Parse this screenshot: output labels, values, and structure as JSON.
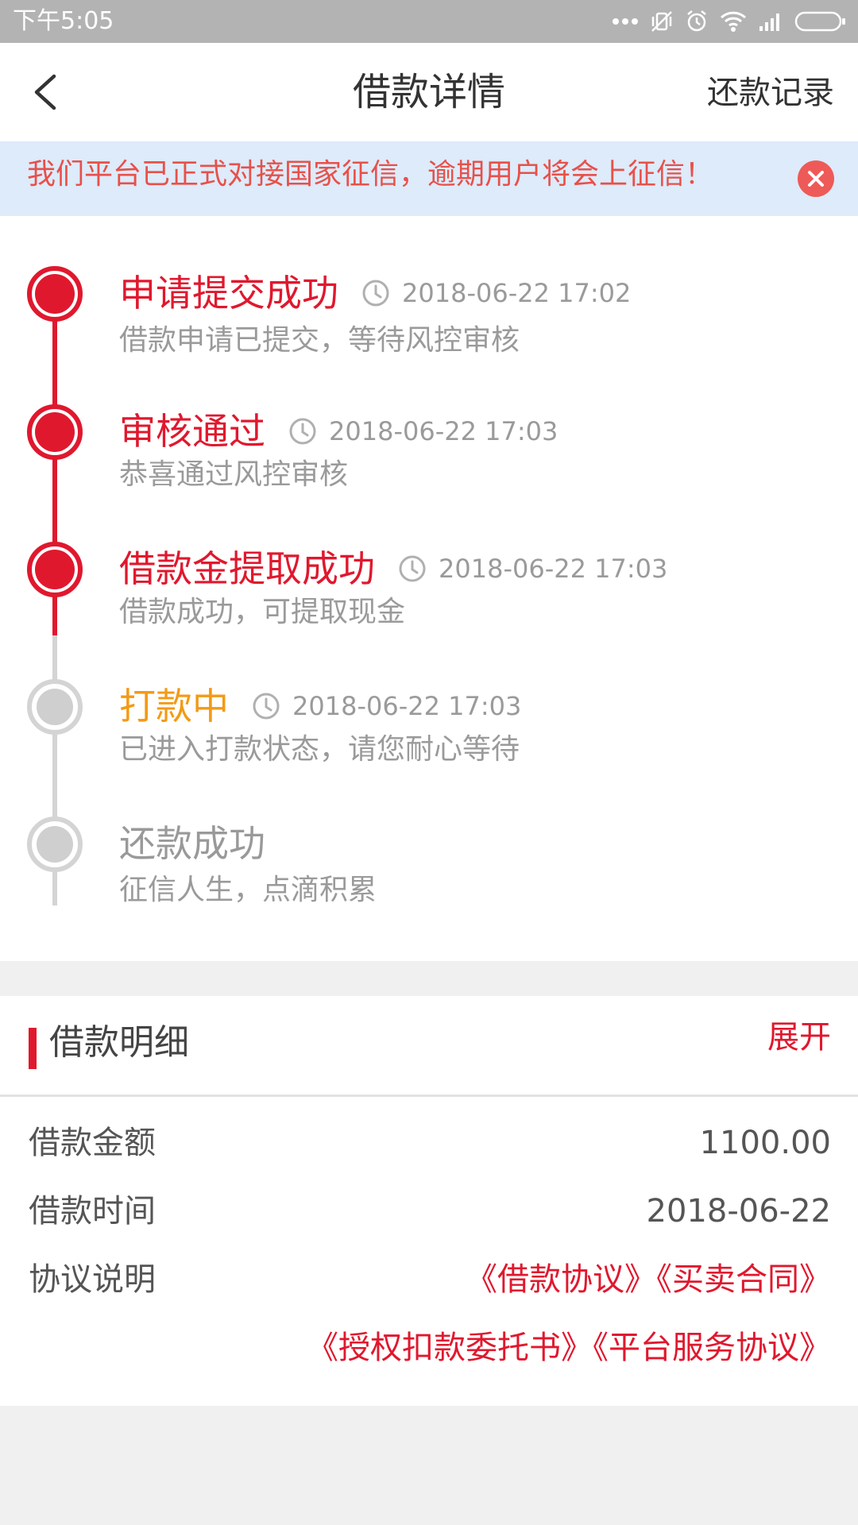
{
  "status_bar": {
    "time": "下午5:05",
    "icons": [
      "more-dots-icon",
      "vibrate-off-icon",
      "alarm-icon",
      "wifi-icon",
      "signal-icon",
      "battery-icon"
    ]
  },
  "nav": {
    "title": "借款详情",
    "right_label": "还款记录",
    "back_icon": "chevron-left-icon"
  },
  "notice": {
    "text": "我们平台已正式对接国家征信，逾期用户将会上征信！",
    "close_icon": "close-icon"
  },
  "timeline": {
    "steps": [
      {
        "title": "申请提交成功",
        "time": "2018-06-22 17:02",
        "desc": "借款申请已提交，等待风控审核",
        "state": "done"
      },
      {
        "title": "审核通过",
        "time": "2018-06-22 17:03",
        "desc": "恭喜通过风控审核",
        "state": "done"
      },
      {
        "title": "借款金提取成功",
        "time": "2018-06-22 17:03",
        "desc": "借款成功，可提取现金",
        "state": "done"
      },
      {
        "title": "打款中",
        "time": "2018-06-22 17:03",
        "desc": "已进入打款状态，请您耐心等待",
        "state": "current"
      },
      {
        "title": "还款成功",
        "time": "",
        "desc": "征信人生，点滴积累",
        "state": "pending"
      }
    ]
  },
  "details": {
    "title": "借款明细",
    "toggle_label": "展开",
    "rows": [
      {
        "label": "借款金额",
        "value": "1100.00"
      },
      {
        "label": "借款时间",
        "value": "2018-06-22"
      },
      {
        "label": "协议说明",
        "value": "《借款协议》《买卖合同》"
      },
      {
        "label": "",
        "value": "《授权扣款委托书》《平台服务协议》"
      }
    ]
  },
  "colors": {
    "accent_red": "#e0182e",
    "in_progress_orange": "#f39a16",
    "notice_bg": "#ddebfa",
    "notice_text": "#e8504a",
    "pending_gray": "#cfcfcf"
  }
}
